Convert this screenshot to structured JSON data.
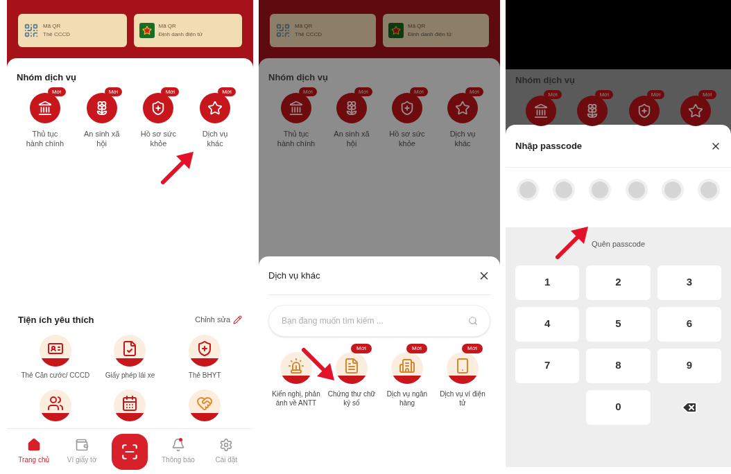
{
  "home_screen": {
    "qr_cards": [
      {
        "title": "Mã QR",
        "subtitle": "Thẻ CCCD"
      },
      {
        "title": "Mã QR",
        "subtitle": "Định danh điện tử"
      }
    ],
    "service_group": {
      "title": "Nhóm dịch vụ",
      "items": [
        {
          "label": "Thủ tục hành chính",
          "badge": "Mới"
        },
        {
          "label": "An sinh xã hội",
          "badge": "Mới"
        },
        {
          "label": "Hồ sơ sức khỏe",
          "badge": "Mới"
        },
        {
          "label": "Dịch vụ khác",
          "badge": "Mới"
        }
      ]
    },
    "favorites": {
      "title": "Tiện ích yêu thích",
      "edit_label": "Chỉnh sửa",
      "items": [
        {
          "label": "Thẻ Căn cước/ CCCD"
        },
        {
          "label": "Giấy phép lái xe"
        },
        {
          "label": "Thẻ BHYT"
        }
      ]
    },
    "nav": [
      {
        "kind": "tab",
        "label": "Trang chủ",
        "selected": true,
        "dot": false
      },
      {
        "kind": "tab",
        "label": "Ví giấy tờ",
        "selected": false,
        "dot": false
      },
      {
        "kind": "scan",
        "selected": false
      },
      {
        "kind": "tab",
        "label": "Thông báo",
        "selected": false,
        "dot": true
      },
      {
        "kind": "tab",
        "label": "Cài đặt",
        "selected": false,
        "dot": false
      }
    ]
  },
  "other_services_screen": {
    "background": {
      "qr_cards": [
        {
          "title": "Mã QR",
          "subtitle": "Thẻ CCCD"
        },
        {
          "title": "Mã QR",
          "subtitle": "Định danh điện tử"
        }
      ],
      "service_group": {
        "title": "Nhóm dịch vụ",
        "items": [
          {
            "label": "Thủ tục hành chính",
            "badge": "Mới"
          },
          {
            "label": "An sinh xã hội",
            "badge": "Mới"
          },
          {
            "label": "Hồ sơ sức khỏe",
            "badge": "Mới"
          },
          {
            "label": "Dịch vụ khác",
            "badge": "Mới"
          }
        ]
      }
    },
    "sheet": {
      "title": "Dịch vụ khác",
      "search": {
        "placeholder": "Bạn đang muốn tìm kiếm ..."
      },
      "items": [
        {
          "label": "Kiến nghị, phản ánh về ANTT"
        },
        {
          "label": "Chứng thư chữ ký số",
          "badge": "Mới"
        },
        {
          "label": "Dịch vụ ngân hàng",
          "badge": "Mới"
        },
        {
          "label": "Dịch vụ ví điện tử",
          "badge": "Mới"
        }
      ]
    }
  },
  "passcode_screen": {
    "background": {
      "service_group": {
        "title": "Nhóm dịch vụ",
        "items": [
          {
            "badge": "Mới"
          },
          {
            "badge": "Mới"
          },
          {
            "badge": "Mới"
          },
          {
            "badge": "Mới"
          }
        ]
      }
    },
    "sheet": {
      "title": "Nhập passcode",
      "digits": [
        {
          "filled": false
        },
        {
          "filled": false
        },
        {
          "filled": false
        },
        {
          "filled": false
        },
        {
          "filled": false
        },
        {
          "filled": false
        }
      ],
      "forgot_link": "Quên passcode",
      "keys": [
        {
          "kind": "digit",
          "label": "1"
        },
        {
          "kind": "digit",
          "label": "2"
        },
        {
          "kind": "digit",
          "label": "3"
        },
        {
          "kind": "digit",
          "label": "4"
        },
        {
          "kind": "digit",
          "label": "5"
        },
        {
          "kind": "digit",
          "label": "6"
        },
        {
          "kind": "digit",
          "label": "7"
        },
        {
          "kind": "digit",
          "label": "8"
        },
        {
          "kind": "digit",
          "label": "9"
        },
        {
          "kind": "blank"
        },
        {
          "kind": "digit",
          "label": "0"
        },
        {
          "kind": "backspace"
        }
      ]
    }
  }
}
